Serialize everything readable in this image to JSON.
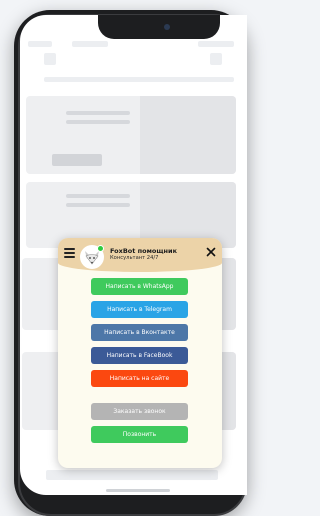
{
  "widget": {
    "title": "FoxBot помощник",
    "subtitle": "Консультант 24/7",
    "icons": {
      "menu": "hamburger-menu-icon",
      "close": "close-icon",
      "avatar": "fox-avatar-icon"
    },
    "buttons": [
      {
        "label": "Написать в WhatsApp",
        "color": "#3fca5d"
      },
      {
        "label": "Написать в Telegram",
        "color": "#2aa4e6"
      },
      {
        "label": "Написать в Вконтакте",
        "color": "#4d77a8"
      },
      {
        "label": "Написать в FaceBook",
        "color": "#3b5a97"
      },
      {
        "label": "Написать на сайте",
        "color": "#fb4810"
      },
      {
        "label": "Заказать звонок",
        "color": "#b4b4b4"
      },
      {
        "label": "Позвонить",
        "color": "#3fca5d"
      }
    ],
    "colors": {
      "header": "#ecd3a8",
      "panel": "#fdfbef"
    }
  }
}
